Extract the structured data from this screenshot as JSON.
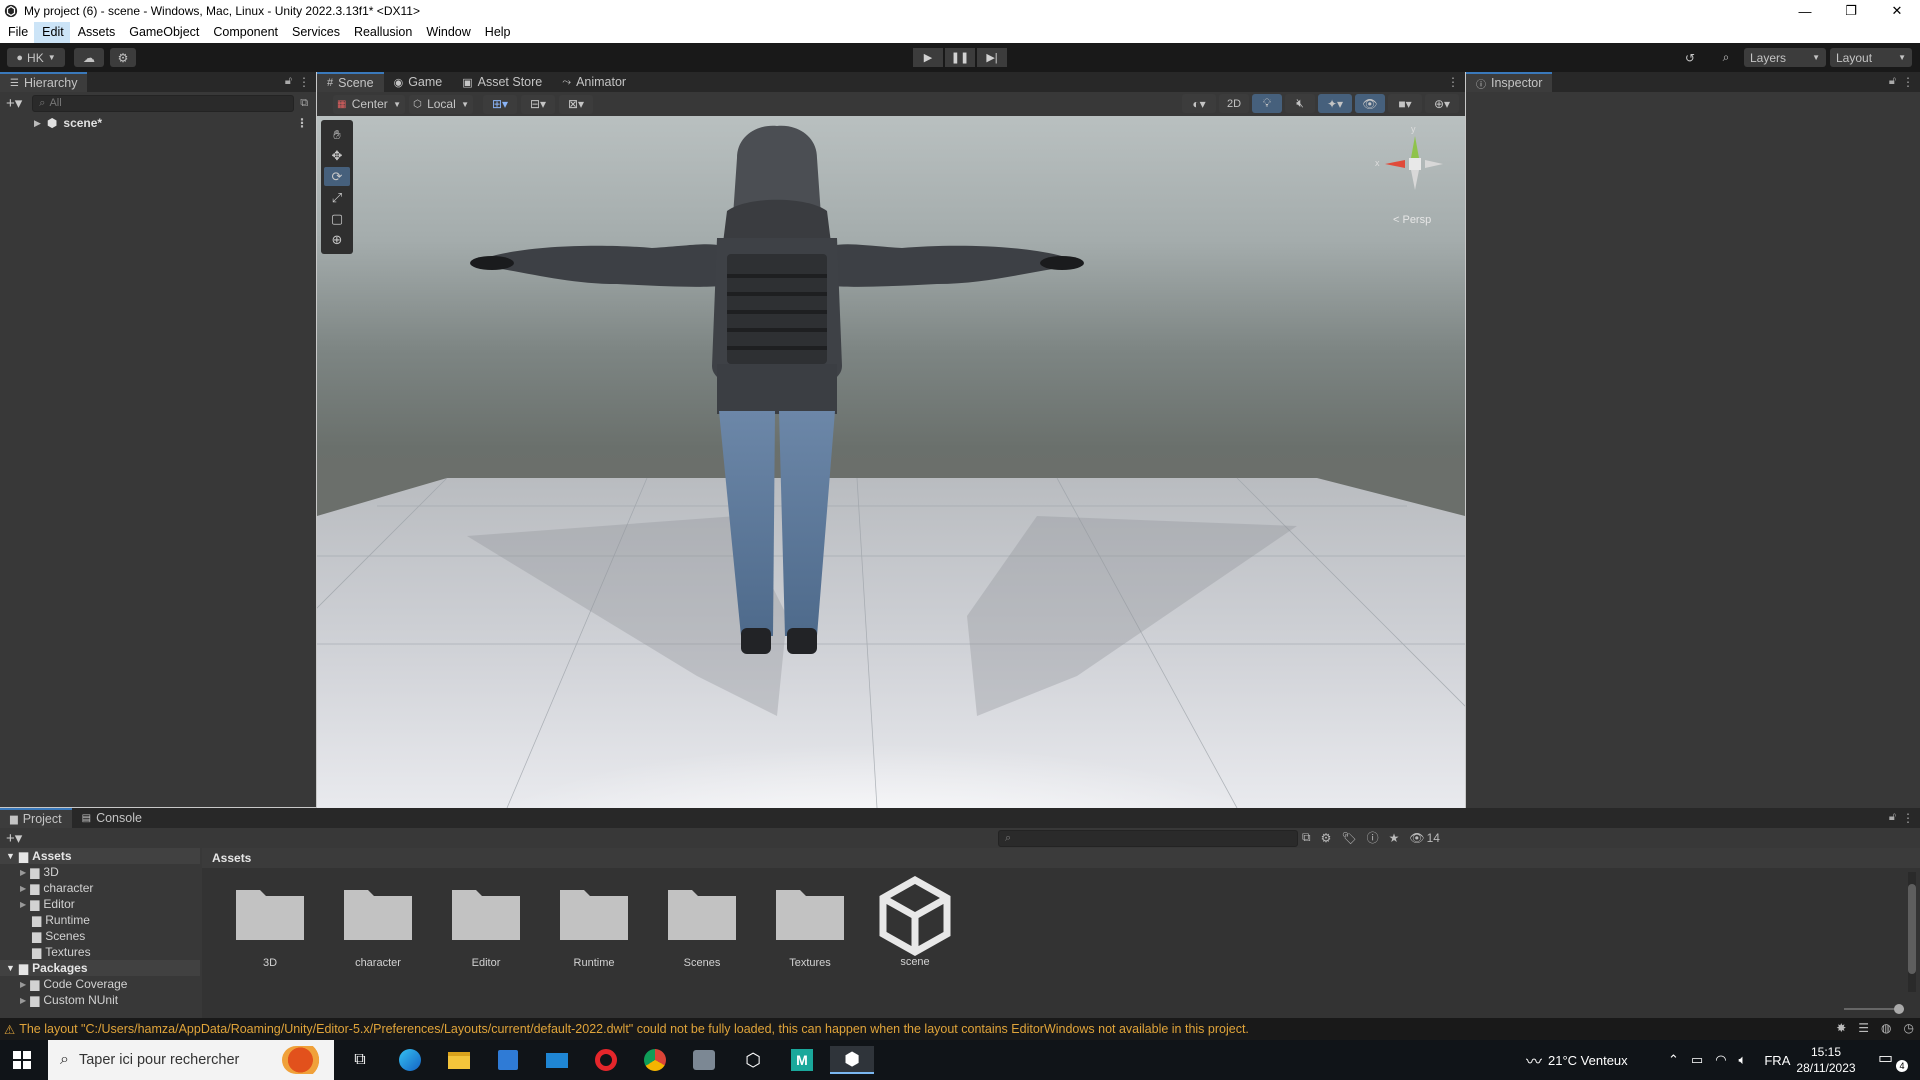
{
  "window": {
    "title": "My project (6) - scene - Windows, Mac, Linux - Unity 2022.3.13f1* <DX11>",
    "controls": [
      "—",
      "❐",
      "✕"
    ]
  },
  "menu": [
    "File",
    "Edit",
    "Assets",
    "GameObject",
    "Component",
    "Services",
    "Reallusion",
    "Window",
    "Help"
  ],
  "toolbar": {
    "account": "HK",
    "layers": "Layers",
    "layout": "Layout"
  },
  "hierarchy": {
    "tab": "Hierarchy",
    "search_placeholder": "All",
    "items": [
      {
        "label": "scene*"
      }
    ]
  },
  "scene_tabs": [
    "Scene",
    "Game",
    "Asset Store",
    "Animator"
  ],
  "scene_toolbar": {
    "pivot": "Center",
    "space": "Local",
    "mode_2d": "2D"
  },
  "gizmo": {
    "label": "< Persp",
    "y": "y",
    "x": "x"
  },
  "inspector": {
    "tab": "Inspector"
  },
  "project": {
    "tabs": [
      "Project",
      "Console"
    ],
    "hidden_count": "14",
    "breadcrumb": "Assets",
    "tree": [
      {
        "label": "Assets",
        "header": true
      },
      {
        "label": "3D"
      },
      {
        "label": "character"
      },
      {
        "label": "Editor"
      },
      {
        "label": "Runtime"
      },
      {
        "label": "Scenes"
      },
      {
        "label": "Textures"
      },
      {
        "label": "Packages",
        "header": true
      },
      {
        "label": "Code Coverage"
      },
      {
        "label": "Custom NUnit"
      }
    ],
    "assets": [
      {
        "label": "3D",
        "kind": "folder"
      },
      {
        "label": "character",
        "kind": "folder"
      },
      {
        "label": "Editor",
        "kind": "folder"
      },
      {
        "label": "Runtime",
        "kind": "folder"
      },
      {
        "label": "Scenes",
        "kind": "folder"
      },
      {
        "label": "Textures",
        "kind": "folder"
      },
      {
        "label": "scene",
        "kind": "unity-scene"
      }
    ]
  },
  "status": {
    "message": "The layout \"C:/Users/hamza/AppData/Roaming/Unity/Editor-5.x/Preferences/Layouts/current/default-2022.dwlt\" could not be fully loaded, this can happen when the layout contains EditorWindows not available in this project."
  },
  "taskbar": {
    "search_placeholder": "Taper ici pour rechercher",
    "weather": "21°C  Venteux",
    "language": "FRA",
    "time": "15:15",
    "date": "28/11/2023",
    "notifications": "4"
  },
  "colors": {
    "accent": "#3a79bb",
    "panel": "#383838",
    "warning": "#e0a43a"
  }
}
